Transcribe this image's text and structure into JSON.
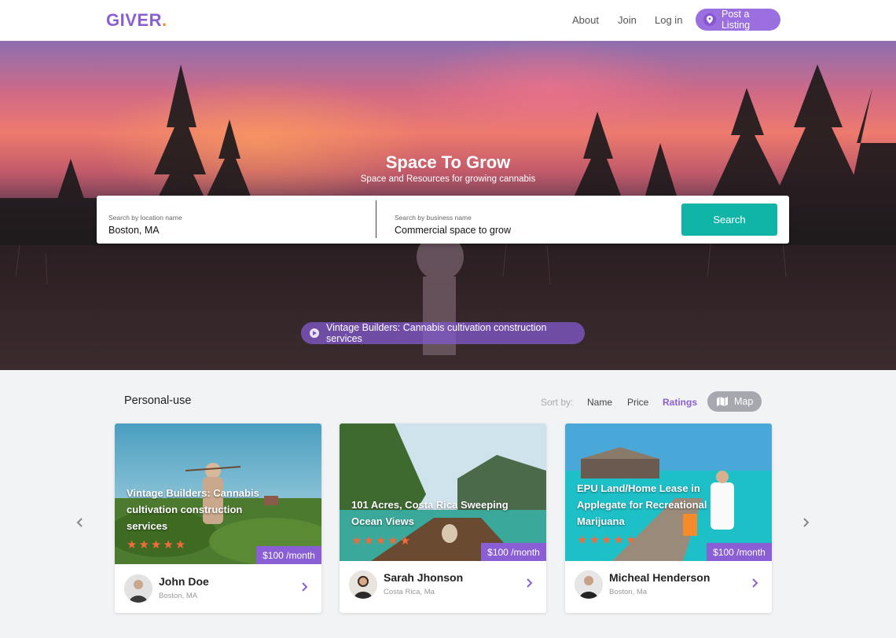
{
  "nav": {
    "logo": "GIVER",
    "logo_dot": ".",
    "links": [
      "About",
      "Join",
      "Log in"
    ],
    "post_label": "Post a Listing"
  },
  "hero": {
    "title": "Space To Grow",
    "subtitle": "Space and Resources for growing cannabis",
    "search": {
      "location_label": "Search by location name",
      "location_value": "Boston, MA",
      "business_label": "Search by business name",
      "business_value": "Commercial space to grow",
      "button": "Search"
    },
    "promo": "Vintage Builders: Cannabis cultivation construction services"
  },
  "listings": {
    "section_title": "Personal-use",
    "sort_label": "Sort by:",
    "sort_options": [
      "Name",
      "Price",
      "Ratings"
    ],
    "active_sort": "Ratings",
    "map_label": "Map",
    "cards": [
      {
        "title": "Vintage Builders: Cannabis cultivation construction services",
        "stars": "★★★★★",
        "price": "$100 /month",
        "owner": "John Doe",
        "location": "Boston, MA"
      },
      {
        "title": "101 Acres, Costa Rica Sweeping Ocean Views",
        "stars": "★★★★★",
        "price": "$100 /month",
        "owner": "Sarah Jhonson",
        "location": "Costa Rica, Ma"
      },
      {
        "title": "EPU Land/Home Lease in Applegate for Recreational Marijuana",
        "stars": "★★★★★",
        "price": "$100 /month",
        "owner": "Micheal Henderson",
        "location": "Boston, Ma"
      }
    ]
  },
  "colors": {
    "brand": "#8a5fd6",
    "accent_orange": "#f58a2b",
    "search_button": "#11b5a8",
    "stars": "#f56a3a"
  },
  "icons": [
    "location-pin-icon",
    "play-icon",
    "map-icon",
    "chevron-left-icon",
    "chevron-right-icon",
    "star-icon"
  ]
}
